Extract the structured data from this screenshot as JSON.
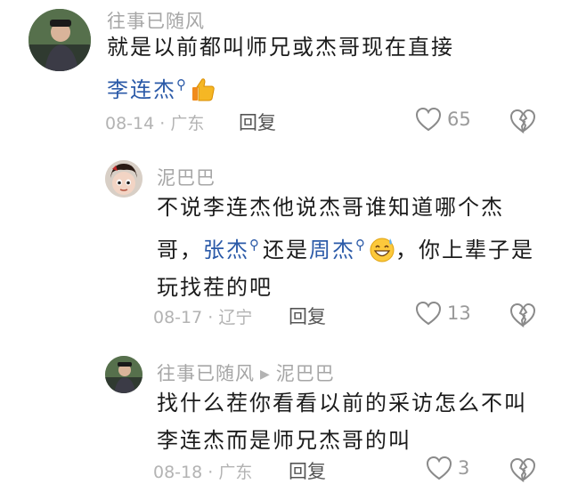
{
  "comments": [
    {
      "username": "往事已随风",
      "text_pre": "就是以前都叫师兄或杰哥现在直接",
      "mention": "李连杰",
      "date": "08-14",
      "location": "广东",
      "reply_label": "回复",
      "likes": "65",
      "emoji": "thumbs-up"
    },
    {
      "username": "泥巴巴",
      "text_1": "不说李连杰他说杰哥谁知道哪个杰哥，",
      "mention_1": "张杰",
      "text_2": "还是",
      "mention_2": "周杰",
      "text_3": "，你上辈子是玩找茬的吧",
      "date": "08-17",
      "location": "辽宁",
      "reply_label": "回复",
      "likes": "13",
      "emoji": "grinning-sweat"
    },
    {
      "username": "往事已随风",
      "reply_to": "泥巴巴",
      "text": "找什么茬你看看以前的采访怎么不叫李连杰而是师兄杰哥的叫",
      "date": "08-18",
      "location": "广东",
      "reply_label": "回复",
      "likes": "3"
    }
  ],
  "colors": {
    "mention": "#2b5aa8",
    "meta": "#b3b3b3"
  }
}
